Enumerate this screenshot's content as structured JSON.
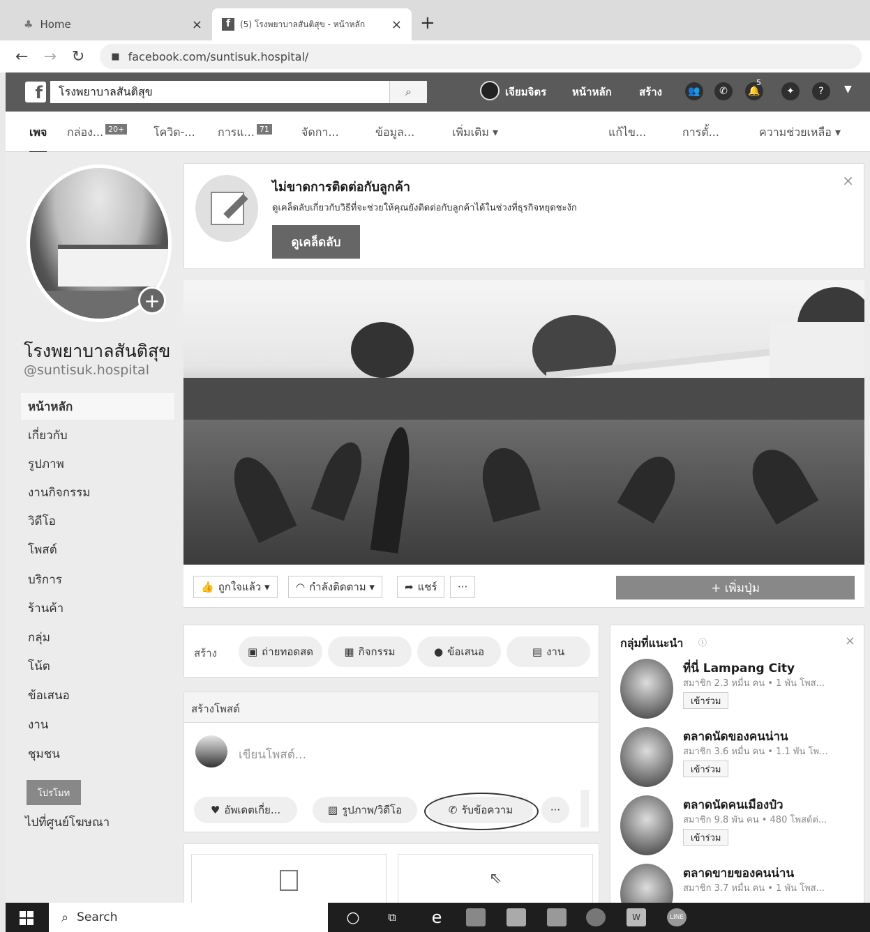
{
  "browser": {
    "tabs": [
      {
        "label": "Home",
        "close": "×"
      },
      {
        "label": "(5) โรงพยาบาลสันติสุข - หน้าหลัก",
        "close": "×"
      }
    ],
    "new_tab": "+",
    "url": "facebook.com/suntisuk.hospital/"
  },
  "fb_header": {
    "logo": "f",
    "search_value": "โรงพยาบาลสันติสุข",
    "user": "เจียมจิตร",
    "home": "หน้าหลัก",
    "create": "สร้าง",
    "notif_count": "5"
  },
  "page_tabs": [
    {
      "label": "เพจ"
    },
    {
      "label": "กล่อง...",
      "badge": "20+"
    },
    {
      "label": "โควิด-..."
    },
    {
      "label": "การแ...",
      "badge": "71"
    },
    {
      "label": "จัดกา..."
    },
    {
      "label": "ข้อมูล..."
    },
    {
      "label": "เพิ่มเติม ▾"
    },
    {
      "label": "แก้ไข..."
    },
    {
      "label": "การตั้..."
    },
    {
      "label": "ความช่วยเหลือ ▾"
    }
  ],
  "page": {
    "name": "โรงพยาบาลสันติสุข",
    "handle": "@suntisuk.hospital"
  },
  "sidebar": [
    {
      "label": "หน้าหลัก",
      "active": true
    },
    {
      "label": "เกี่ยวกับ"
    },
    {
      "label": "รูปภาพ"
    },
    {
      "label": "งานกิจกรรม"
    },
    {
      "label": "วิดีโอ"
    },
    {
      "label": "โพสต์"
    },
    {
      "label": "บริการ"
    },
    {
      "label": "ร้านค้า"
    },
    {
      "label": "กลุ่ม"
    },
    {
      "label": "โน้ต"
    },
    {
      "label": "ข้อเสนอ"
    },
    {
      "label": "งาน"
    },
    {
      "label": "ชุมชน"
    }
  ],
  "promote_label": "โปรโมท",
  "ad_center_label": "ไปที่ศูนย์โฆษณา",
  "tip": {
    "title": "ไม่ขาดการติดต่อกับลูกค้า",
    "text": "ดูเคล็ดลับเกี่ยวกับวิธีที่จะช่วยให้คุณยังติดต่อกับลูกค้าได้ในช่วงที่ธุรกิจหยุดชะงัก",
    "button": "ดูเคล็ดลับ"
  },
  "actions": {
    "like": "ถูกใจแล้ว ▾",
    "follow": "กำลังติดตาม ▾",
    "share": "แชร์",
    "more": "···",
    "add_button": "+ เพิ่มปุ่ม"
  },
  "create": {
    "label": "สร้าง",
    "live": "ถ่ายทอดสด",
    "event": "กิจกรรม",
    "offer": "ข้อเสนอ",
    "job": "งาน"
  },
  "post": {
    "header": "สร้างโพสต์",
    "placeholder": "เขียนโพสต์...",
    "update": "อัพเดตเกี่ย...",
    "photo": "รูปภาพ/วิดีโอ",
    "messages": "รับข้อความ",
    "more": "···"
  },
  "groups": {
    "title": "กลุ่มที่แนะนำ",
    "join_label": "เข้าร่วม",
    "items": [
      {
        "name": "ที่นี่ Lampang City",
        "meta": "สมาชิก 2.3 หมื่น คน • 1 พัน โพส..."
      },
      {
        "name": "ตลาดนัดของคนน่าน",
        "meta": "สมาชิก 3.6 หมื่น คน • 1.1 พัน โพ..."
      },
      {
        "name": "ตลาดนัดคนเมืองป๋ว",
        "meta": "สมาชิก 9.8 พัน คน • 480 โพสต์ต่..."
      },
      {
        "name": "ตลาดขายของคนน่าน",
        "meta": "สมาชิก 3.7 หมื่น คน • 1 พัน โพส..."
      }
    ]
  },
  "taskbar": {
    "search": "Search"
  }
}
